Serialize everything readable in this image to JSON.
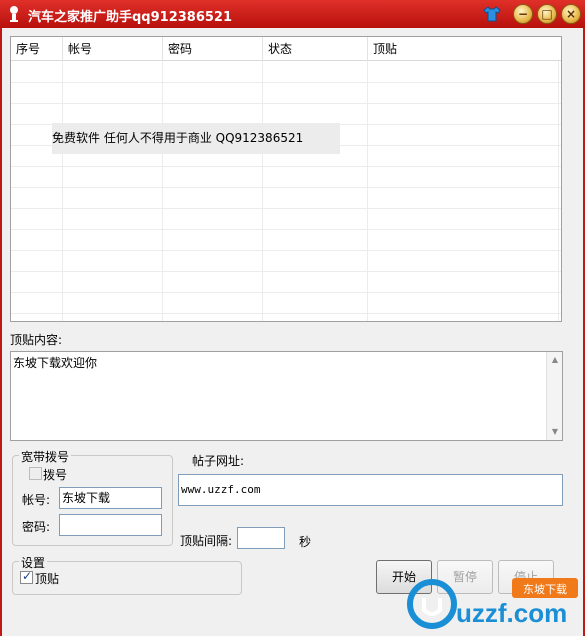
{
  "window": {
    "title": "汽车之家推广助手qq912386521"
  },
  "titlebar_buttons": {
    "minimize": "−",
    "maximize": "□",
    "close": "×"
  },
  "list": {
    "columns": [
      "序号",
      "帐号",
      "密码",
      "状态",
      "顶贴"
    ],
    "notice": "免费软件 任何人不得用于商业 QQ912386521"
  },
  "post_content": {
    "label": "顶贴内容:",
    "value": "东坡下载欢迎你"
  },
  "broadband": {
    "title": "宽带拨号",
    "dial_label": "拨号",
    "dial_checked": false,
    "account_label": "帐号:",
    "account_value": "东坡下载",
    "password_label": "密码:",
    "password_value": ""
  },
  "post_url": {
    "label": "帖子网址:",
    "value": "www.uzzf.com"
  },
  "interval": {
    "label": "顶贴间隔:",
    "value": "",
    "unit": "秒"
  },
  "settings": {
    "title": "设置",
    "bump_label": "顶贴",
    "bump_checked": true
  },
  "buttons": {
    "start": "开始",
    "pause": "暂停",
    "stop": "停止"
  },
  "watermark": {
    "brand": "uzzf.com",
    "tag": "东坡下载"
  },
  "colors": {
    "title_red": "#c8160f",
    "accent_blue": "#1a8fd6"
  }
}
